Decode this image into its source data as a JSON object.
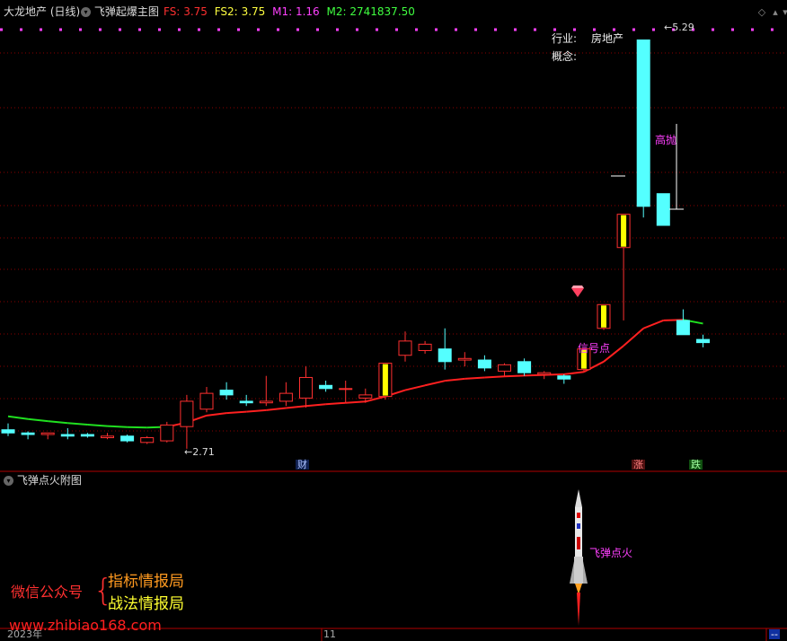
{
  "header": {
    "stock_title": "大龙地产 (日线)",
    "indicator_title": "飞弹起爆主图",
    "fs_label": "FS:",
    "fs_value": "3.75",
    "fs2_label": "FS2:",
    "fs2_value": "3.75",
    "m1_label": "M1:",
    "m1_value": "1.16",
    "m2_label": "M2:",
    "m2_value": "2741837.50",
    "controls": [
      "diamond-icon",
      "chevron-up-icon",
      "chevron-down-icon"
    ]
  },
  "info": {
    "industry_label": "行业:",
    "industry_value": "房地产",
    "concept_label": "概念:"
  },
  "annotations": {
    "high_price": "5.29",
    "low_price": "2.71",
    "sell_signal": "高抛",
    "buy_signal": "信号点",
    "ignite_signal": "飞弹点火"
  },
  "event_markers": [
    {
      "text": "财",
      "color": "#4060ff"
    },
    {
      "text": "涨",
      "color": "#ff3030"
    },
    {
      "text": "跌",
      "color": "#20c020"
    }
  ],
  "sub_panel": {
    "title": "飞弹点火附图"
  },
  "watermark": {
    "wechat": "微信公众号",
    "line1": "指标情报局",
    "line2": "战法情报局",
    "url": "www.zhibiao168.com"
  },
  "axis": {
    "year_label": "2023年",
    "month_label": "11",
    "corner_label": "--"
  },
  "colors": {
    "up_candle": "#ff3030",
    "down_candle": "#54ffff",
    "ma_rising": "#ff2020",
    "ma_falling": "#20e020",
    "signal_candle_fill": "#ffff00",
    "magenta_text": "#ff40ff",
    "grid": "#8a0000"
  },
  "chart_data": {
    "type": "candlestick",
    "candles": [
      {
        "o": 2.83,
        "h": 2.87,
        "l": 2.79,
        "c": 2.81
      },
      {
        "o": 2.81,
        "h": 2.82,
        "l": 2.77,
        "c": 2.8
      },
      {
        "o": 2.8,
        "h": 2.81,
        "l": 2.77,
        "c": 2.81
      },
      {
        "o": 2.8,
        "h": 2.84,
        "l": 2.77,
        "c": 2.79
      },
      {
        "o": 2.8,
        "h": 2.81,
        "l": 2.78,
        "c": 2.79
      },
      {
        "o": 2.78,
        "h": 2.81,
        "l": 2.77,
        "c": 2.79
      },
      {
        "o": 2.79,
        "h": 2.8,
        "l": 2.75,
        "c": 2.76
      },
      {
        "o": 2.75,
        "h": 2.79,
        "l": 2.74,
        "c": 2.78
      },
      {
        "o": 2.76,
        "h": 2.88,
        "l": 2.75,
        "c": 2.86
      },
      {
        "o": 2.85,
        "h": 3.05,
        "l": 2.71,
        "c": 3.01
      },
      {
        "o": 2.96,
        "h": 3.1,
        "l": 2.94,
        "c": 3.06
      },
      {
        "o": 3.08,
        "h": 3.13,
        "l": 3.02,
        "c": 3.05
      },
      {
        "o": 3.01,
        "h": 3.05,
        "l": 2.98,
        "c": 3.0
      },
      {
        "o": 3.0,
        "h": 3.17,
        "l": 2.98,
        "c": 3.01
      },
      {
        "o": 3.01,
        "h": 3.13,
        "l": 2.98,
        "c": 3.06
      },
      {
        "o": 3.03,
        "h": 3.23,
        "l": 2.97,
        "c": 3.16
      },
      {
        "o": 3.11,
        "h": 3.14,
        "l": 3.07,
        "c": 3.09
      },
      {
        "o": 3.09,
        "h": 3.14,
        "l": 3.0,
        "c": 3.09
      },
      {
        "o": 3.03,
        "h": 3.09,
        "l": 3.0,
        "c": 3.05
      },
      {
        "o": 3.04,
        "h": 3.25,
        "l": 3.02,
        "c": 3.25
      },
      {
        "o": 3.3,
        "h": 3.45,
        "l": 3.26,
        "c": 3.39
      },
      {
        "o": 3.33,
        "h": 3.39,
        "l": 3.31,
        "c": 3.37
      },
      {
        "o": 3.34,
        "h": 3.47,
        "l": 3.21,
        "c": 3.26
      },
      {
        "o": 3.27,
        "h": 3.32,
        "l": 3.23,
        "c": 3.28
      },
      {
        "o": 3.27,
        "h": 3.3,
        "l": 3.2,
        "c": 3.22
      },
      {
        "o": 3.2,
        "h": 3.25,
        "l": 3.17,
        "c": 3.24
      },
      {
        "o": 3.26,
        "h": 3.28,
        "l": 3.17,
        "c": 3.19
      },
      {
        "o": 3.18,
        "h": 3.2,
        "l": 3.15,
        "c": 3.19
      },
      {
        "o": 3.17,
        "h": 3.18,
        "l": 3.12,
        "c": 3.15
      },
      {
        "o": 3.21,
        "h": 3.34,
        "l": 3.2,
        "c": 3.34
      },
      {
        "o": 3.47,
        "h": 3.62,
        "l": 3.46,
        "c": 3.62
      },
      {
        "o": 3.98,
        "h": 4.19,
        "l": 3.52,
        "c": 4.19
      },
      {
        "o": 5.29,
        "h": 5.29,
        "l": 4.17,
        "c": 4.24
      },
      {
        "o": 4.32,
        "h": 4.32,
        "l": 4.12,
        "c": 4.12
      },
      {
        "o": 3.52,
        "h": 3.59,
        "l": 3.43,
        "c": 3.43
      },
      {
        "o": 3.4,
        "h": 3.43,
        "l": 3.35,
        "c": 3.38
      }
    ],
    "signal_candles": [
      19,
      29,
      30,
      31
    ],
    "ma": [
      2.915,
      2.898,
      2.884,
      2.872,
      2.862,
      2.853,
      2.847,
      2.844,
      2.848,
      2.876,
      2.92,
      2.935,
      2.944,
      2.954,
      2.967,
      2.98,
      2.991,
      3.0,
      3.008,
      3.04,
      3.08,
      3.11,
      3.139,
      3.152,
      3.16,
      3.167,
      3.172,
      3.176,
      3.18,
      3.195,
      3.26,
      3.36,
      3.47,
      3.52,
      3.524,
      3.5
    ]
  }
}
